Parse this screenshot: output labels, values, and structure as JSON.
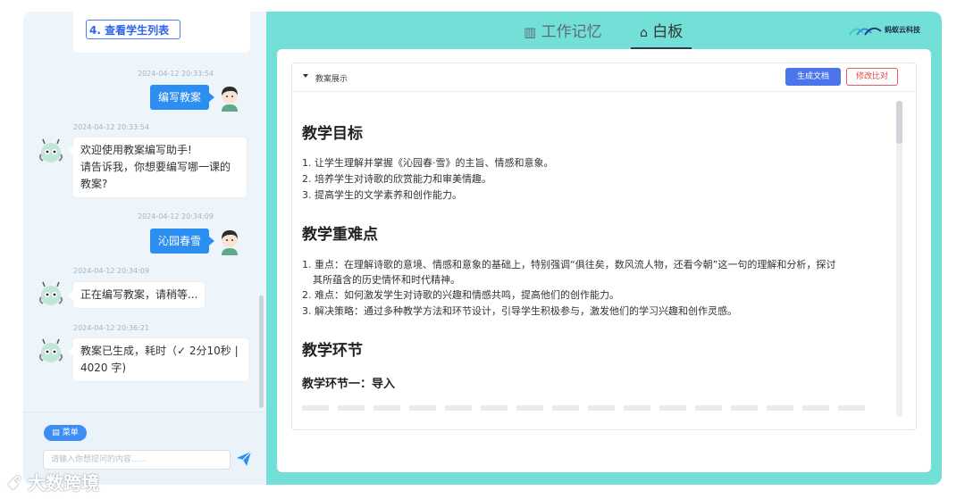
{
  "chat": {
    "menu_link": "4. 查看学生列表",
    "messages": [
      {
        "role": "user",
        "time": "2024-04-12 20:33:54",
        "text": "编写教案"
      },
      {
        "role": "bot",
        "time": "2024-04-12 20:33:54",
        "lines": [
          "欢迎使用教案编写助手!",
          "请告诉我，你想要编写哪一课的",
          "教案?"
        ]
      },
      {
        "role": "user",
        "time": "2024-04-12 20:34:09",
        "text": "沁园春雪"
      },
      {
        "role": "bot",
        "time": "2024-04-12 20:34:09",
        "lines": [
          "正在编写教案，请稍等..."
        ]
      },
      {
        "role": "bot",
        "time": "2024-04-12 20:36:21",
        "lines": [
          "教案已生成，耗时（✓ 2分10秒 |",
          "4020 字)"
        ]
      }
    ],
    "menu_button": "菜单",
    "input_placeholder": "请输入你想提问的内容......"
  },
  "tabs": [
    {
      "label": "工作记忆",
      "icon": "memory-icon",
      "active": false
    },
    {
      "label": "白板",
      "icon": "whiteboard-icon",
      "active": true
    }
  ],
  "logo_text": "蚂蚁云科技",
  "doc": {
    "title": "教案展示",
    "generate_button": "生成文档",
    "compare_button": "修改比对",
    "sections": {
      "goal_title": "教学目标",
      "goal_items": [
        "1. 让学生理解并掌握《沁园春·雪》的主旨、情感和意象。",
        "2. 培养学生对诗歌的欣赏能力和审美情趣。",
        "3. 提高学生的文学素养和创作能力。"
      ],
      "key_title": "教学重难点",
      "key_items": [
        "1. 重点：在理解诗歌的意境、情感和意象的基础上，特别强调“俱往矣，数风流人物，还看今朝”这一句的理解和分析，探讨",
        "其所蕴含的历史情怀和时代精神。",
        "2. 难点：如何激发学生对诗歌的兴趣和情感共鸣，提高他们的创作能力。",
        "3. 解决策略：通过多种教学方法和环节设计，引导学生积极参与，激发他们的学习兴趣和创作灵感。"
      ],
      "steps_title": "教学环节",
      "step1_title": "教学环节一：导入"
    }
  },
  "watermark": "大数跨境",
  "colors": {
    "accent": "#2b8ef0",
    "panel": "#73e0d8",
    "primary_button": "#4c75ec",
    "danger": "#e34646"
  }
}
